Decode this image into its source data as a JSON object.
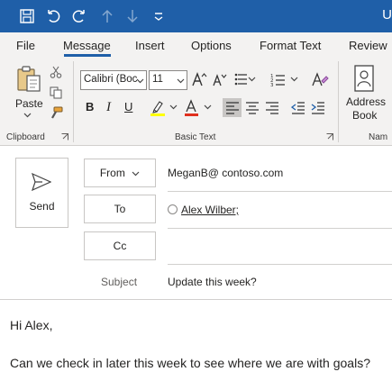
{
  "title_bar": {
    "title": "U",
    "icons": [
      "save-icon",
      "undo-icon",
      "redo-icon",
      "up-arrow-icon",
      "down-arrow-icon",
      "customize-quick-access-icon"
    ]
  },
  "tabs": [
    {
      "label": "File"
    },
    {
      "label": "Message"
    },
    {
      "label": "Insert"
    },
    {
      "label": "Options"
    },
    {
      "label": "Format Text"
    },
    {
      "label": "Review"
    }
  ],
  "active_tab": "Message",
  "ribbon": {
    "clipboard": {
      "group_label": "Clipboard",
      "paste_label": "Paste"
    },
    "basic_text": {
      "group_label": "Basic Text",
      "font_name": "Calibri (Boc",
      "font_size": "11",
      "bold": "B",
      "italic": "I",
      "underline": "U"
    },
    "names": {
      "group_label": "Nam",
      "address_book_line1": "Address",
      "address_book_line2": "Book"
    }
  },
  "colors": {
    "title_bar": "#1f5fa8",
    "highlight": "#ffff00",
    "font_color": "#e0301e"
  },
  "compose": {
    "send_label": "Send",
    "from_label": "From",
    "from_value": "MeganB@ contoso.com",
    "to_label": "To",
    "to_value": "Alex Wilber;",
    "cc_label": "Cc",
    "cc_value": "",
    "subject_label": "Subject",
    "subject_value": "Update this week?"
  },
  "message_body": {
    "greeting": "Hi Alex,",
    "line1": "Can we check in later this week to see where we are with goals?"
  }
}
